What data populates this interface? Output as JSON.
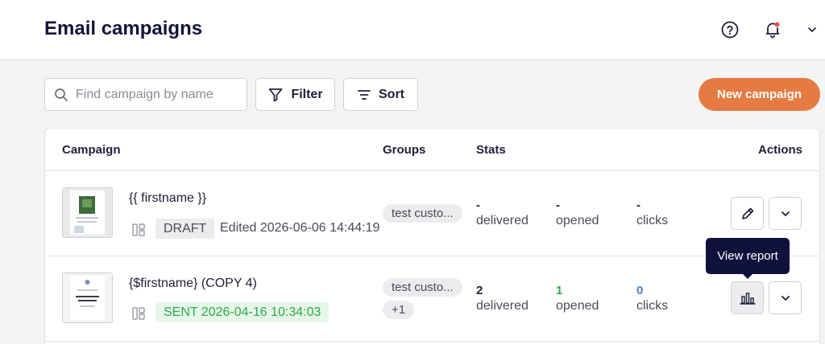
{
  "header": {
    "title": "Email campaigns",
    "icons": {
      "help": "help-circle-icon",
      "notifications": "bell-icon",
      "menu": "chevron-down-icon"
    },
    "notification_dot_color": "#e5534b"
  },
  "toolbar": {
    "search_placeholder": "Find campaign by name",
    "search_value": "",
    "filter_label": "Filter",
    "sort_label": "Sort",
    "new_campaign_label": "New campaign",
    "new_campaign_color": "#e57b42"
  },
  "table": {
    "columns": {
      "campaign": "Campaign",
      "groups": "Groups",
      "stats": "Stats",
      "actions": "Actions"
    },
    "rows": [
      {
        "name": "{{ firstname }}",
        "status": "DRAFT",
        "edited": "Edited 2026-06-06 14:44:19",
        "groups": [
          "test custo..."
        ],
        "stats": {
          "delivered": {
            "value": "-",
            "label": "delivered"
          },
          "opened": {
            "value": "-",
            "label": "opened"
          },
          "clicks": {
            "value": "-",
            "label": "clicks"
          }
        },
        "primary_action_icon": "pencil-icon"
      },
      {
        "name": "{$firstname} (COPY 4)",
        "status": "SENT 2026-04-16 10:34:03",
        "edited": "",
        "groups": [
          "test custo...",
          "+1"
        ],
        "stats": {
          "delivered": {
            "value": "2",
            "label": "delivered"
          },
          "opened": {
            "value": "1",
            "label": "opened"
          },
          "clicks": {
            "value": "0",
            "label": "clicks"
          }
        },
        "primary_action_icon": "bar-chart-icon"
      }
    ]
  },
  "tooltip": {
    "text": "View report"
  },
  "colors": {
    "opened": "#2fa84f",
    "clicks": "#4a7fd6",
    "sent_badge": "#2fa84f"
  }
}
